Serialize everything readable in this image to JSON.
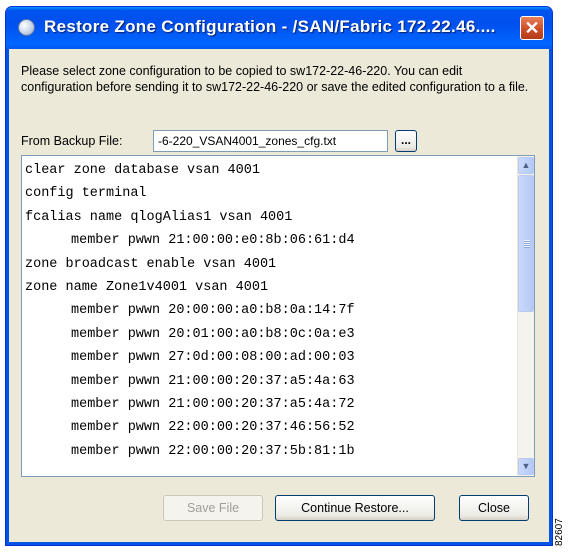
{
  "window": {
    "title": "Restore Zone Configuration - /SAN/Fabric 172.22.46....",
    "close_symbol": "✕",
    "icon": "app-globe-icon"
  },
  "description": "Please select zone configuration to be copied to sw172-22-46-220. You can edit configuration before sending it to sw172-22-46-220 or save the edited configuration to a file.",
  "backup": {
    "label": "From Backup File:",
    "value": "-6-220_VSAN4001_zones_cfg.txt",
    "browse_label": "..."
  },
  "config_text": {
    "lines": [
      "clear zone database vsan 4001",
      "config terminal",
      "fcalias name qlogAlias1 vsan 4001",
      "member pwwn 21:00:00:e0:8b:06:61:d4",
      "zone broadcast enable vsan 4001",
      "zone name Zone1v4001 vsan 4001",
      "member pwwn 20:00:00:a0:b8:0a:14:7f",
      "member pwwn 20:01:00:a0:b8:0c:0a:e3",
      "member pwwn 27:0d:00:08:00:ad:00:03",
      "member pwwn 21:00:00:20:37:a5:4a:63",
      "member pwwn 21:00:00:20:37:a5:4a:72",
      "member pwwn 22:00:00:20:37:46:56:52",
      "member pwwn 22:00:00:20:37:5b:81:1b"
    ],
    "scroll_up_icon": "▲",
    "scroll_down_icon": "▼"
  },
  "buttons": {
    "save": "Save File",
    "continue": "Continue Restore...",
    "close": "Close"
  },
  "figure_id": "82607",
  "colors": {
    "titlebar": "#0054e3",
    "dialog_bg": "#ece9d8",
    "close_button": "#cc4d28"
  }
}
